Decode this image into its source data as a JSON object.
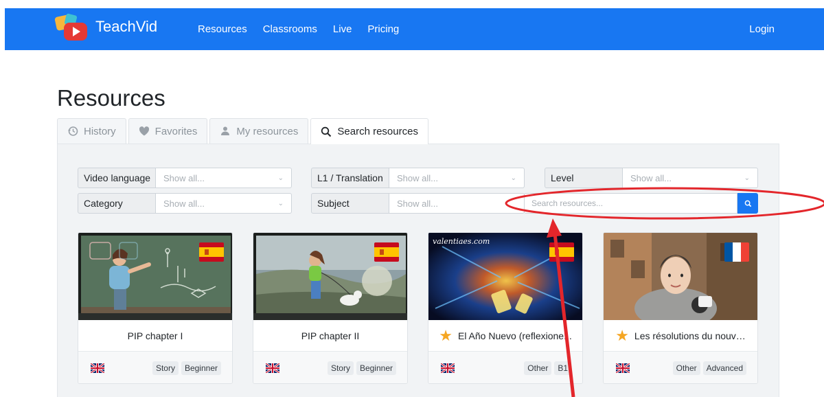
{
  "brand": {
    "name": "TeachVid"
  },
  "nav": {
    "links": [
      "Resources",
      "Classrooms",
      "Live",
      "Pricing"
    ],
    "login": "Login"
  },
  "page": {
    "title": "Resources"
  },
  "tabs": [
    {
      "label": "History",
      "icon": "history-icon",
      "active": false
    },
    {
      "label": "Favorites",
      "icon": "heart-icon",
      "active": false
    },
    {
      "label": "My resources",
      "icon": "user-icon",
      "active": false
    },
    {
      "label": "Search resources",
      "icon": "search-icon",
      "active": true
    }
  ],
  "filters": {
    "video_language": {
      "label": "Video language",
      "value": "Show all..."
    },
    "l1_translation": {
      "label": "L1 / Translation",
      "value": "Show all..."
    },
    "level": {
      "label": "Level",
      "value": "Show all..."
    },
    "category": {
      "label": "Category",
      "value": "Show all..."
    },
    "subject": {
      "label": "Subject",
      "value": "Show all..."
    }
  },
  "search": {
    "placeholder": "Search resources..."
  },
  "cards": [
    {
      "title": "PIP chapter I",
      "starred": false,
      "language_flag": "spain-flag",
      "tags": [
        "Story",
        "Beginner"
      ]
    },
    {
      "title": "PIP chapter II",
      "starred": false,
      "language_flag": "spain-flag",
      "tags": [
        "Story",
        "Beginner"
      ]
    },
    {
      "title": "El Año Nuevo (reflexione...",
      "starred": true,
      "language_flag": "spain-flag",
      "watermark": "valentiaes.com",
      "tags": [
        "Other",
        "B1"
      ]
    },
    {
      "title": "Les résolutions du nouv…",
      "starred": true,
      "language_flag": "france-flag",
      "tags": [
        "Other",
        "Advanced"
      ]
    }
  ],
  "colors": {
    "primary": "#1877f2",
    "annotation": "#e3262b",
    "star": "#f5a623"
  }
}
